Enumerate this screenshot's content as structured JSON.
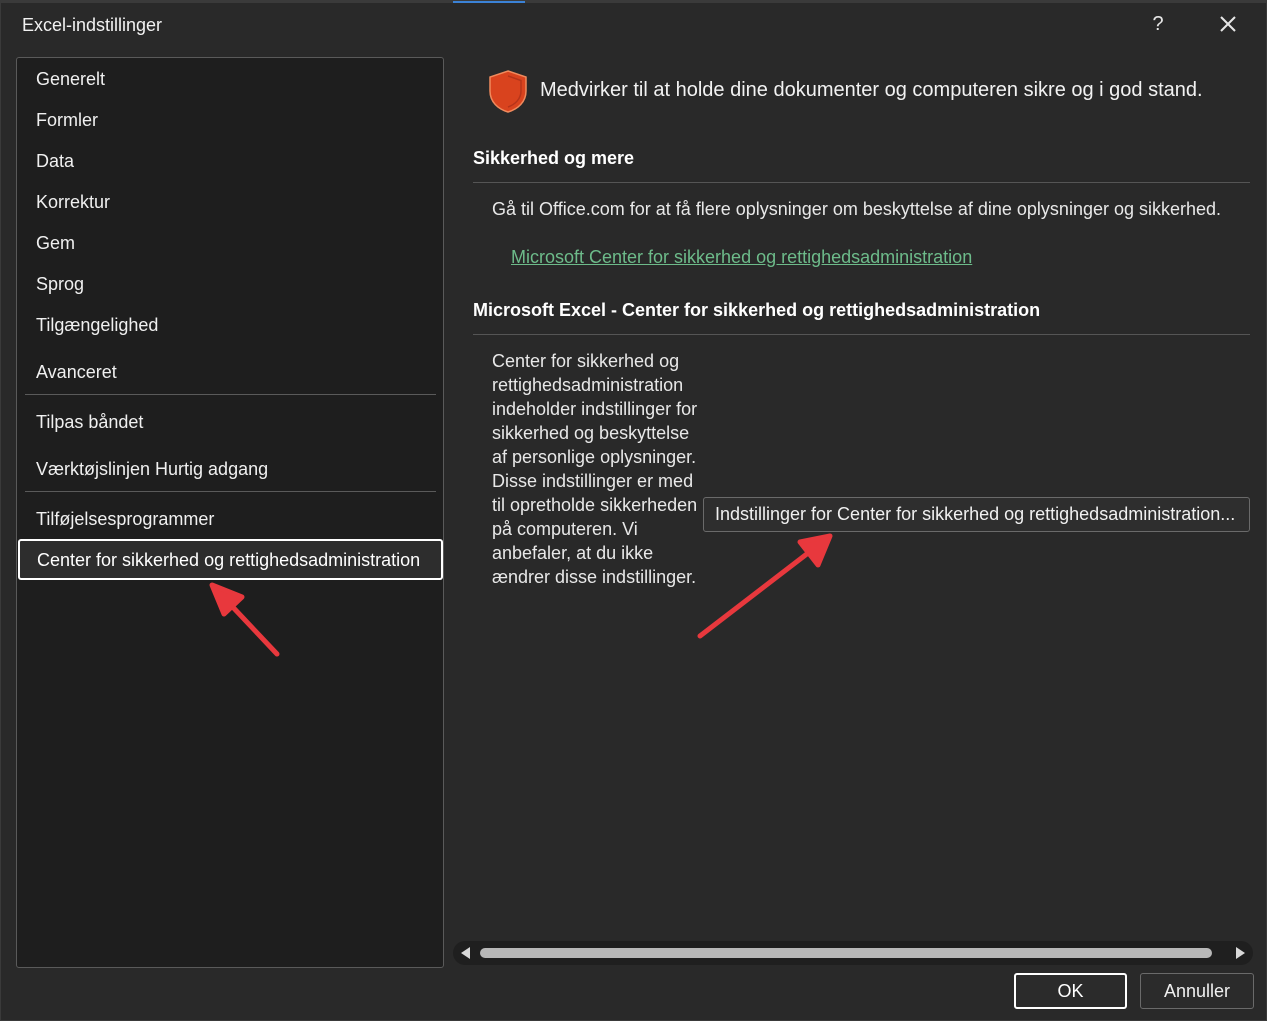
{
  "window": {
    "title": "Excel-indstillinger",
    "help_label": "?",
    "close_icon": "close-icon"
  },
  "sidebar": {
    "items": [
      {
        "label": "Generelt"
      },
      {
        "label": "Formler"
      },
      {
        "label": "Data"
      },
      {
        "label": "Korrektur"
      },
      {
        "label": "Gem"
      },
      {
        "label": "Sprog"
      },
      {
        "label": "Tilgængelighed"
      },
      {
        "label": "Avanceret"
      },
      {
        "label": "Tilpas båndet"
      },
      {
        "label": "Værktøjslinjen Hurtig adgang"
      },
      {
        "label": "Tilføjelsesprogrammer"
      },
      {
        "label": "Center for sikkerhed og rettighedsadministration",
        "selected": true
      }
    ]
  },
  "main": {
    "header_icon": "shield-icon",
    "header_text": "Medvirker til at holde dine dokumenter og computeren sikre og i god stand.",
    "section1_title": "Sikkerhed og mere",
    "section1_text": "Gå til Office.com for at få flere oplysninger om beskyttelse af dine oplysninger og sikkerhed.",
    "section1_link": "Microsoft Center for sikkerhed og rettighedsadministration",
    "section2_title": "Microsoft Excel - Center for sikkerhed og rettighedsadministration",
    "section2_desc": "Center for sikkerhed og rettighedsadministration indeholder indstillinger for sikkerhed og beskyttelse af personlige oplysninger. Disse indstillinger er med til opretholde sikkerheden på computeren. Vi anbefaler, at du ikke ændrer disse indstillinger.",
    "settings_button": "Indstillinger for Center for sikkerhed og rettighedsadministration..."
  },
  "footer": {
    "ok_label": "OK",
    "cancel_label": "Annuller"
  },
  "colors": {
    "link": "#6dbb8a",
    "shield": "#d9431e",
    "annotation_arrow": "#e8383d"
  }
}
